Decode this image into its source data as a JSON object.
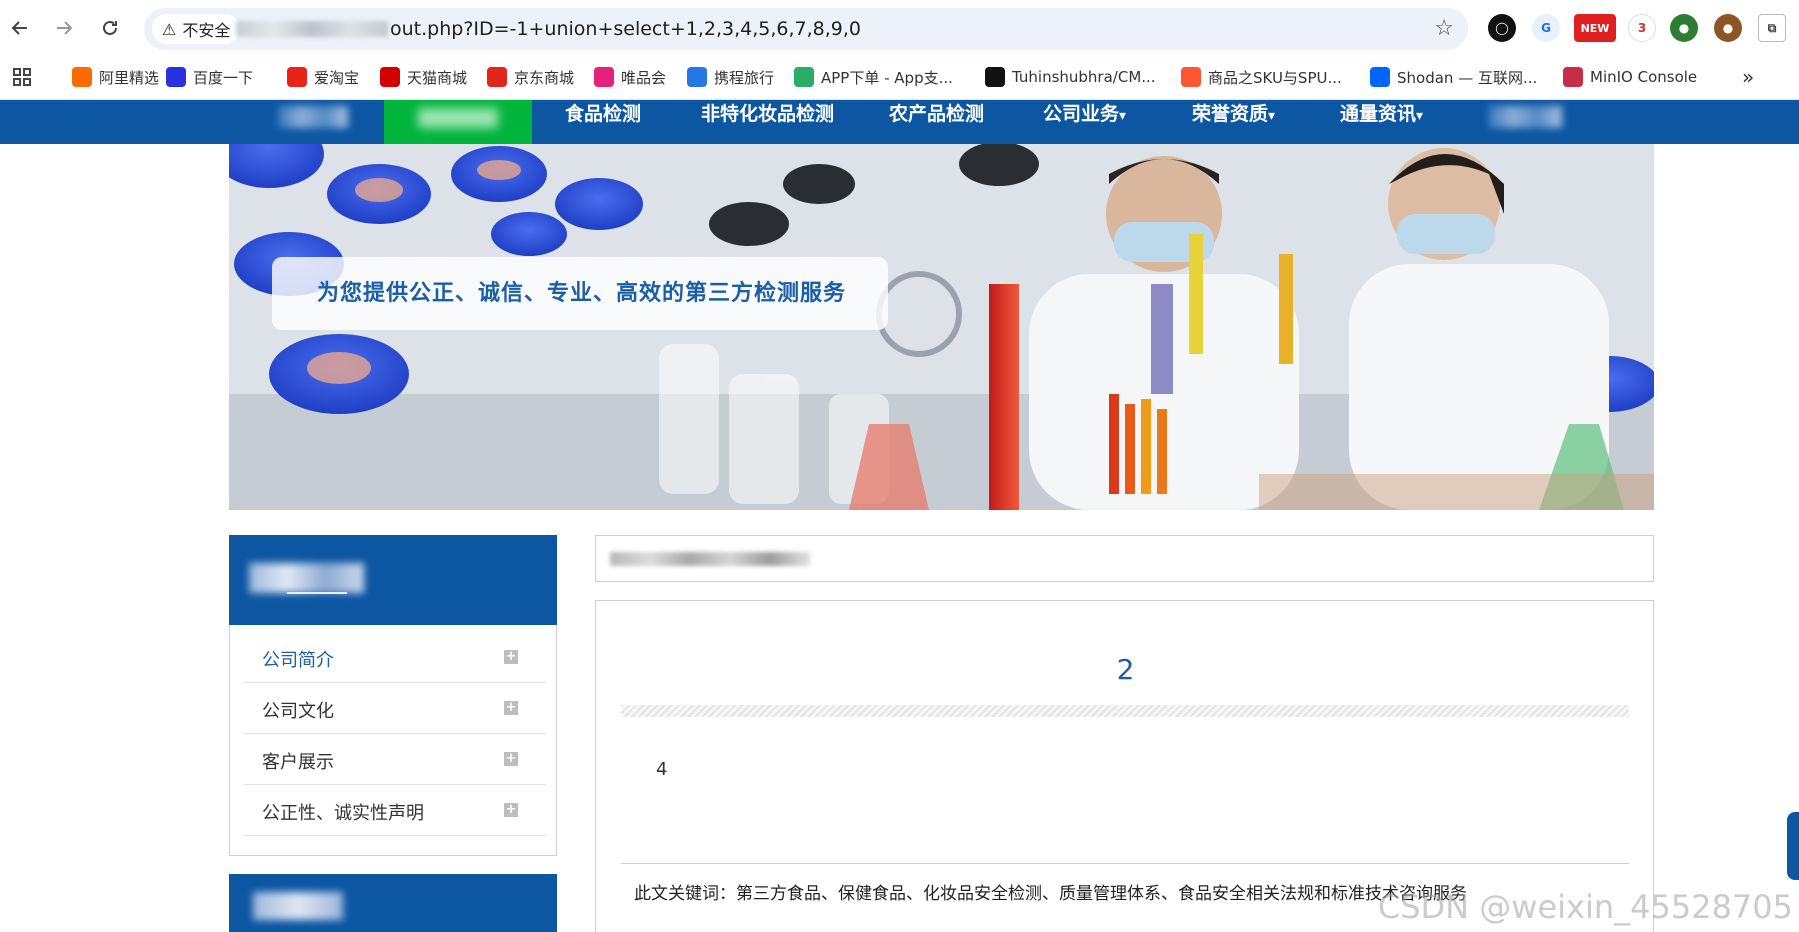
{
  "browser": {
    "security_label": "不安全",
    "url_visible": "out.php?ID=-1+union+select+1,2,3,4,5,6,7,8,9,0",
    "extension_badge_new": "NEW",
    "extension_badge_count": "3"
  },
  "bookmarks": [
    {
      "label": "阿里精选",
      "icon": "alibaba-icon",
      "color": "#ff6a00"
    },
    {
      "label": "百度一下",
      "icon": "baidu-icon",
      "color": "#2932e1"
    },
    {
      "label": "爱淘宝",
      "icon": "taobao-icon",
      "color": "#e8231a"
    },
    {
      "label": "天猫商城",
      "icon": "tmall-icon",
      "color": "#d40000"
    },
    {
      "label": "京东商城",
      "icon": "jd-icon",
      "color": "#e1251b"
    },
    {
      "label": "唯品会",
      "icon": "vipshop-icon",
      "color": "#e6217b"
    },
    {
      "label": "携程旅行",
      "icon": "ctrip-icon",
      "color": "#2577e3"
    },
    {
      "label": "APP下单 - App支...",
      "icon": "wechat-icon",
      "color": "#2aae67"
    },
    {
      "label": "Tuhinshubhra/CM...",
      "icon": "github-icon",
      "color": "#111111"
    },
    {
      "label": "商品之SKU与SPU...",
      "icon": "csdn-icon",
      "color": "#fc5531"
    },
    {
      "label": "Shodan — 互联网...",
      "icon": "zhihu-icon",
      "color": "#0066ff"
    },
    {
      "label": "MinIO Console",
      "icon": "minio-icon",
      "color": "#c72c48"
    }
  ],
  "site_nav": {
    "items": [
      "食品检测",
      "非特化妆品检测",
      "农产品检测",
      "公司业务",
      "荣誉资质",
      "通量资讯"
    ],
    "dropdown_caret": "▾",
    "color": "#0c56a2",
    "active_color": "#00b43c"
  },
  "banner": {
    "slogan": "为您提供公正、诚信、专业、高效的第三方检测服务"
  },
  "sidebar": {
    "items": [
      {
        "label": "公司简介",
        "active": true
      },
      {
        "label": "公司文化",
        "active": false
      },
      {
        "label": "客户展示",
        "active": false
      },
      {
        "label": "公正性、诚实性声明",
        "active": false
      }
    ],
    "expand_glyph": "+"
  },
  "article": {
    "title": "2",
    "body": "4",
    "keywords": "此文关键词：第三方食品、保健食品、化妆品安全检测、质量管理体系、食品安全相关法规和标准技术咨询服务"
  },
  "watermark": "CSDN @weixin_45528705"
}
